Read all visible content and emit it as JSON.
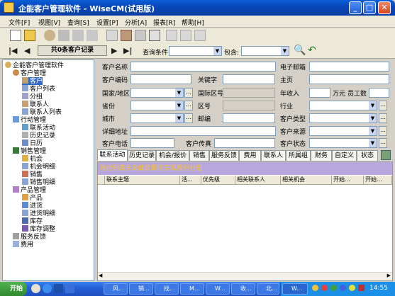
{
  "window": {
    "title": "企能客户管理软件 - WiseCM(试用版)"
  },
  "menu": [
    "文件[F]",
    "视图[V]",
    "查询[S]",
    "设置[P]",
    "分析[A]",
    "报表[R]",
    "帮助[H]"
  ],
  "nav": {
    "record_label": "共0条客户记录",
    "query_label": "查询条件:",
    "contains_label": "包含:",
    "query_value": "",
    "contains_value": ""
  },
  "tree": {
    "root": "企能客户管理软件",
    "groups": [
      {
        "label": "客户管理",
        "items": [
          "客户",
          "客户列表",
          "分组",
          "联系人",
          "联系人列表"
        ]
      },
      {
        "label": "行动管理",
        "items": [
          "联系活动",
          "历史记录",
          "日历"
        ]
      },
      {
        "label": "销售管理",
        "items": [
          "机会",
          "机会明细",
          "销售",
          "销售明细"
        ]
      },
      {
        "label": "产品管理",
        "items": [
          "产品",
          "进货",
          "进货明细",
          "库存",
          "库存调整"
        ]
      }
    ],
    "extra": [
      "服务反馈",
      "费用"
    ]
  },
  "form": {
    "customer_name": "客户名称",
    "customer_code": "客户编码",
    "keyword": "关键字",
    "country": "国家/地区",
    "area_code": "国际区号",
    "province": "省份",
    "zone": "区号",
    "city": "城市",
    "postcode": "邮编",
    "address": "详细地址",
    "phone": "客户电话",
    "fax": "客户传真",
    "email": "电子邮箱",
    "homepage": "主页",
    "revenue": "年收入",
    "revenue_unit": "万元",
    "staff": "员工数",
    "industry": "行业",
    "type": "客户类型",
    "source": "客户来源",
    "status": "客户状态"
  },
  "tabs": [
    "联系活动",
    "历史记录",
    "机会/报价",
    "销售",
    "服务反馈",
    "费用",
    "联系人",
    "所属组",
    "财务",
    "自定义",
    "状态"
  ],
  "grid": {
    "group_hint": "拖动列表头到此处即可实现按列分组",
    "columns": [
      "联系主题",
      "活...",
      "优先级",
      "相关联系人",
      "相关机会",
      "开始...",
      "开始..."
    ]
  },
  "taskbar": {
    "start": "开始",
    "tasks": [
      "风...",
      "销...",
      "找...",
      "M...",
      "W...",
      "收...",
      "北...",
      "W..."
    ],
    "clock": "14:55"
  }
}
